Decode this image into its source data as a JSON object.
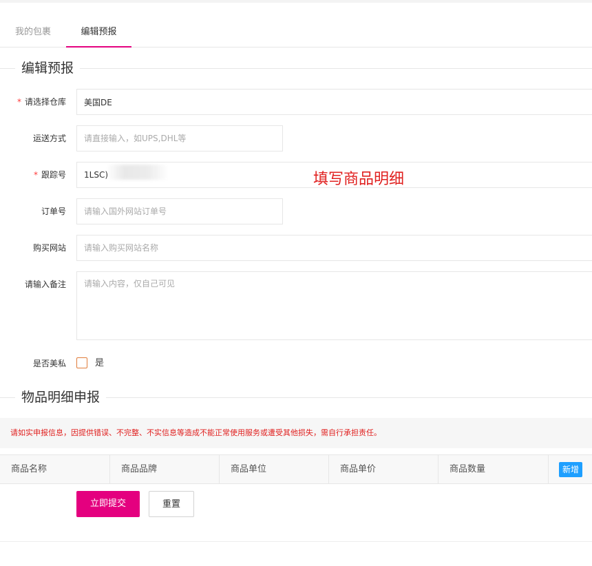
{
  "tabs": [
    {
      "label": "我的包裹"
    },
    {
      "label": "编辑预报"
    }
  ],
  "form": {
    "section_title": "编辑预报",
    "warehouse": {
      "label": "请选择仓库",
      "value": "美国DE"
    },
    "shipping": {
      "label": "运送方式",
      "placeholder": "请直接输入，如UPS,DHL等"
    },
    "tracking": {
      "label": "跟踪号",
      "value": "1LSC)"
    },
    "order": {
      "label": "订单号",
      "placeholder": "请输入国外网站订单号"
    },
    "site": {
      "label": "购买网站",
      "placeholder": "请输入购买网站名称"
    },
    "remark": {
      "label": "请输入备注",
      "placeholder": "请输入内容，仅自己可见"
    },
    "private": {
      "label": "是否美私",
      "option": "是"
    }
  },
  "annotation": "填写商品明细",
  "items": {
    "section_title": "物品明细申报",
    "warning": "请如实申报信息，因提供错误、不完整、不实信息等造成不能正常使用服务或遭受其他损失，需自行承担责任。",
    "columns": [
      "商品名称",
      "商品品牌",
      "商品单位",
      "商品单价",
      "商品数量"
    ],
    "add_label": "新增"
  },
  "actions": {
    "submit": "立即提交",
    "reset": "重置"
  },
  "colors": {
    "accent": "#e4007f",
    "required": "#ff3b3b",
    "warning": "#e0201f",
    "add_button": "#1e9fff"
  }
}
